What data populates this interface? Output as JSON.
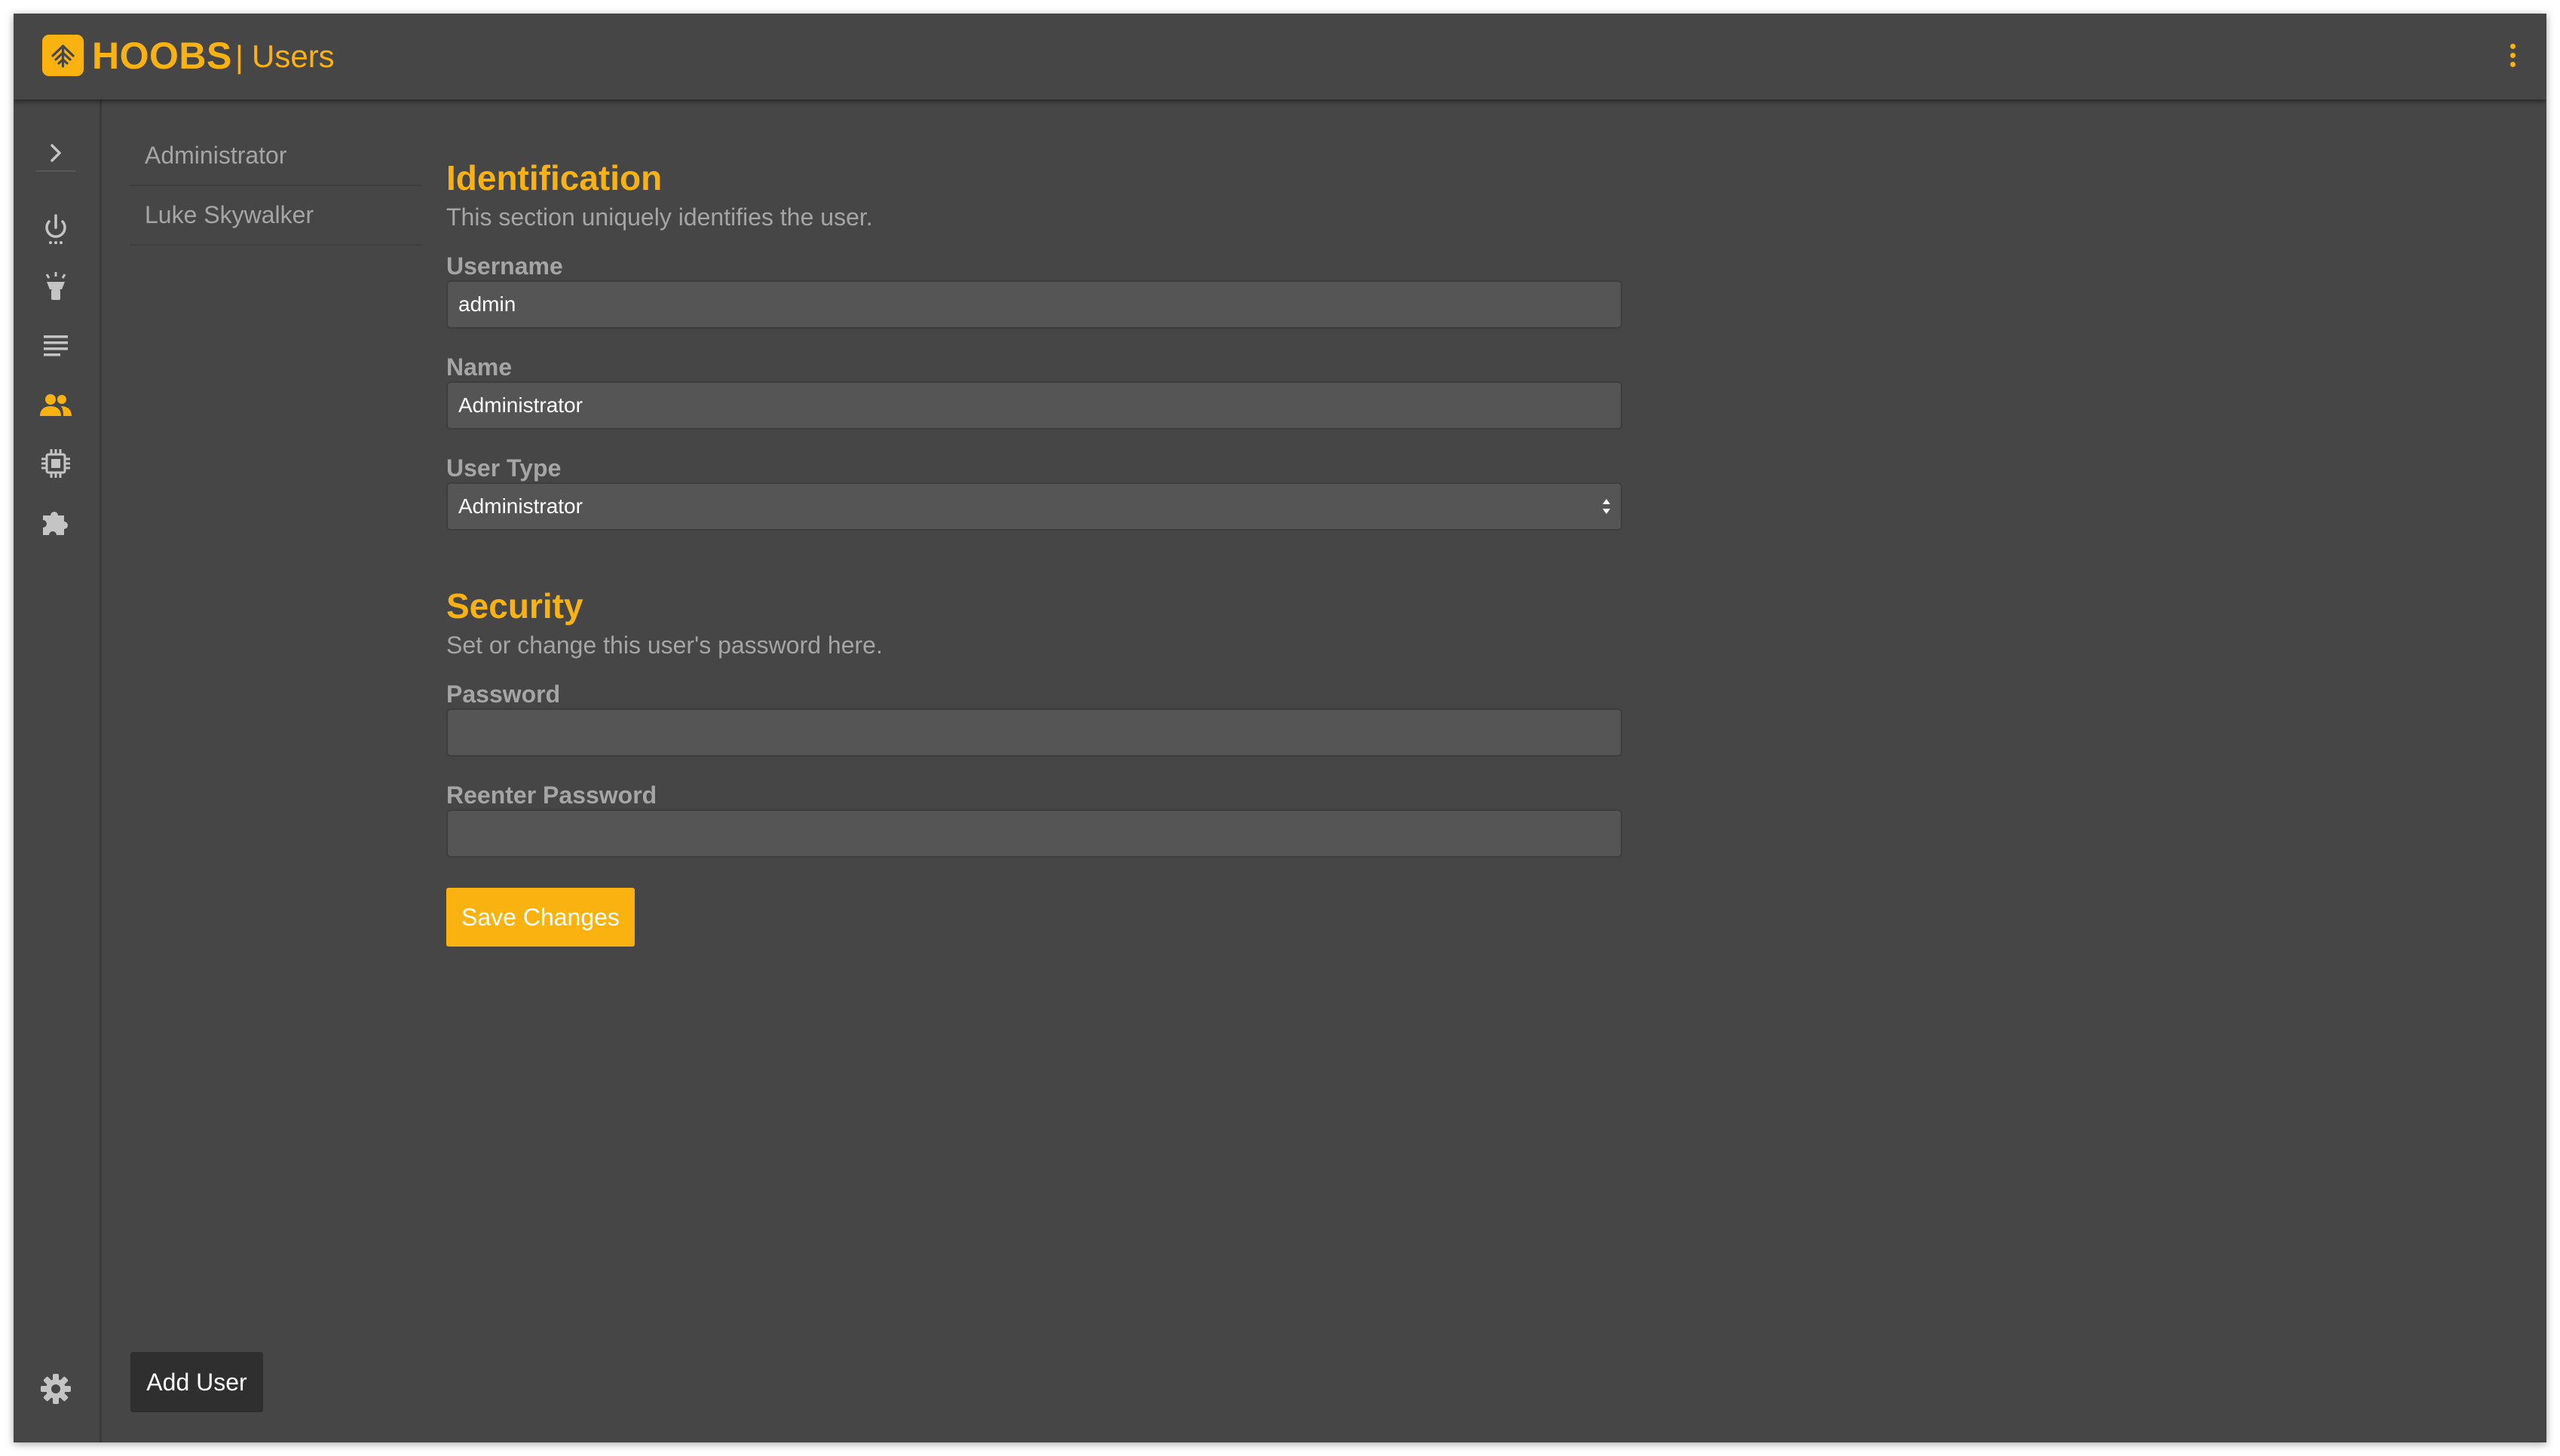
{
  "header": {
    "brand": "HOOBS",
    "separator": "|",
    "section": "Users",
    "menu_icon": "kebab-menu-icon"
  },
  "nav": {
    "icons": [
      "chevron-right-icon",
      "power-icon",
      "light-bulb-icon",
      "log-lines-icon",
      "users-icon",
      "chip-icon",
      "puzzle-icon",
      "gear-icon"
    ],
    "active": "users-icon"
  },
  "users": {
    "items": [
      {
        "label": "Administrator"
      },
      {
        "label": "Luke Skywalker"
      }
    ],
    "add_label": "Add User"
  },
  "identification": {
    "title": "Identification",
    "description": "This section uniquely identifies the user.",
    "username_label": "Username",
    "username_value": "admin",
    "name_label": "Name",
    "name_value": "Administrator",
    "user_type_label": "User Type",
    "user_type_value": "Administrator"
  },
  "security": {
    "title": "Security",
    "description": "Set or change this user's password here.",
    "password_label": "Password",
    "password_value": "",
    "reenter_label": "Reenter Password",
    "reenter_value": ""
  },
  "actions": {
    "save_label": "Save Changes"
  },
  "colors": {
    "accent": "#f9b20f",
    "background": "#464646",
    "field": "#555555",
    "muted_text": "#a5a5a5"
  }
}
